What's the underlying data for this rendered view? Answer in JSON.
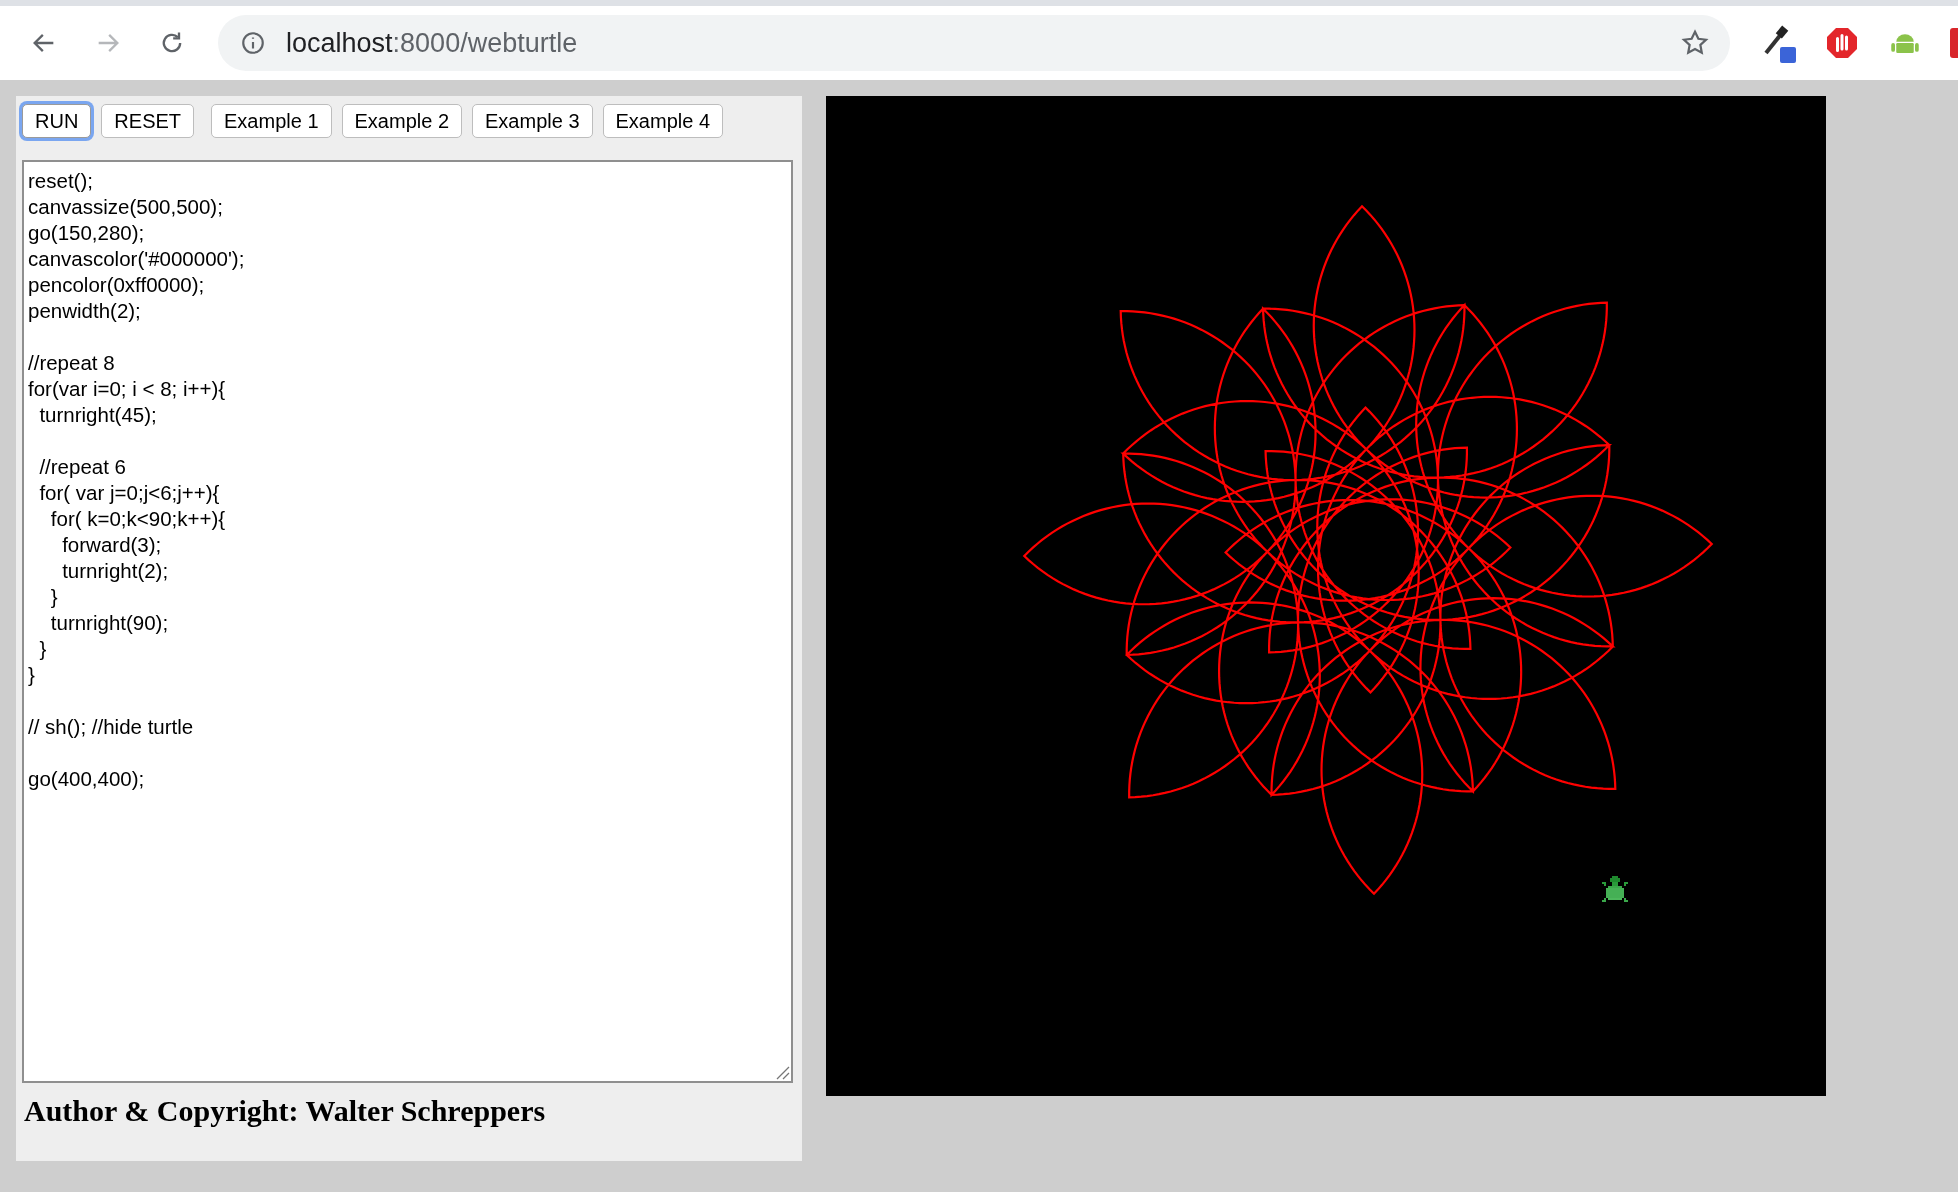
{
  "browser": {
    "url_host": "localhost",
    "url_rest": ":8000/webturtle"
  },
  "buttons": [
    {
      "label": "RUN",
      "focused": true
    },
    {
      "label": "RESET",
      "focused": false
    },
    {
      "label": "Example 1",
      "focused": false
    },
    {
      "label": "Example 2",
      "focused": false
    },
    {
      "label": "Example 3",
      "focused": false
    },
    {
      "label": "Example 4",
      "focused": false
    }
  ],
  "code": "reset();\ncanvassize(500,500);\ngo(150,280);\ncanvascolor('#000000');\npencolor(0xff0000);\npenwidth(2);\n\n//repeat 8\nfor(var i=0; i < 8; i++){\n  turnright(45);\n\n  //repeat 6\n  for( var j=0;j<6;j++){\n    for( k=0;k<90;k++){\n      forward(3);\n      turnright(2);\n    }\n    turnright(90);\n  }\n}\n\n// sh(); //hide turtle\n\ngo(400,400);",
  "footer": "Author & Copyright: Walter Schreppers"
}
